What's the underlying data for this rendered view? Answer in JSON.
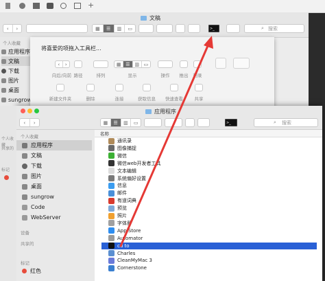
{
  "top_strip": {
    "bg": "#f0f0f0"
  },
  "back_window": {
    "title": "文稿",
    "search_placeholder": "搜索",
    "sidebar": {
      "section_favorites": "个人收藏",
      "items": [
        "应用程序",
        "文稿",
        "下载",
        "图片",
        "桌面",
        "sungrow"
      ]
    }
  },
  "customize_sheet": {
    "title": "将喜爱的项拖入工具栏...",
    "items_row1": [
      "向后/向前",
      "路径",
      "排列",
      "显示",
      "操作",
      "推出",
      "刻录"
    ],
    "items_row2": [
      "新建文件夹",
      "删除",
      "连接",
      "获取信息",
      "快速查看",
      "共享"
    ]
  },
  "front_window": {
    "title": "应用程序",
    "search_placeholder": "搜索",
    "column_header": "名称",
    "sidebar": {
      "section_favorites": "个人收藏",
      "favorites": [
        "应用程序",
        "文稿",
        "下载",
        "图片",
        "桌面",
        "sungrow",
        "Code",
        "WebServer"
      ],
      "section_devices": "设备",
      "section_shared": "共享的",
      "section_tags": "标记",
      "tags": [
        "红色"
      ]
    },
    "files": [
      {
        "name": "通讯录",
        "color": "#b08b5a"
      },
      {
        "name": "图像捕捉",
        "color": "#6a6a6a"
      },
      {
        "name": "微信",
        "color": "#3cb034"
      },
      {
        "name": "微信web开发者工具",
        "color": "#333333"
      },
      {
        "name": "文本编辑",
        "color": "#dcdcdc"
      },
      {
        "name": "系统偏好设置",
        "color": "#7a7a7a"
      },
      {
        "name": "信息",
        "color": "#3b9cf0"
      },
      {
        "name": "邮件",
        "color": "#4a90d9"
      },
      {
        "name": "有道词典",
        "color": "#d83b2f"
      },
      {
        "name": "预览",
        "color": "#7fa9d8"
      },
      {
        "name": "照片",
        "color": "#f0a030"
      },
      {
        "name": "字体册",
        "color": "#a0a0a0"
      },
      {
        "name": "App Store",
        "color": "#2f8ef0"
      },
      {
        "name": "Automator",
        "color": "#9b9b9b"
      },
      {
        "name": "cd to",
        "color": "#111111",
        "selected": true
      },
      {
        "name": "Charles",
        "color": "#5b8fd1"
      },
      {
        "name": "CleanMyMac 3",
        "color": "#6a7ad9"
      },
      {
        "name": "Cornerstone",
        "color": "#3a7fd0"
      }
    ]
  },
  "colors": {
    "accent": "#2960d6",
    "arrow": "#e53935",
    "tag_red": "#e74c3c"
  }
}
